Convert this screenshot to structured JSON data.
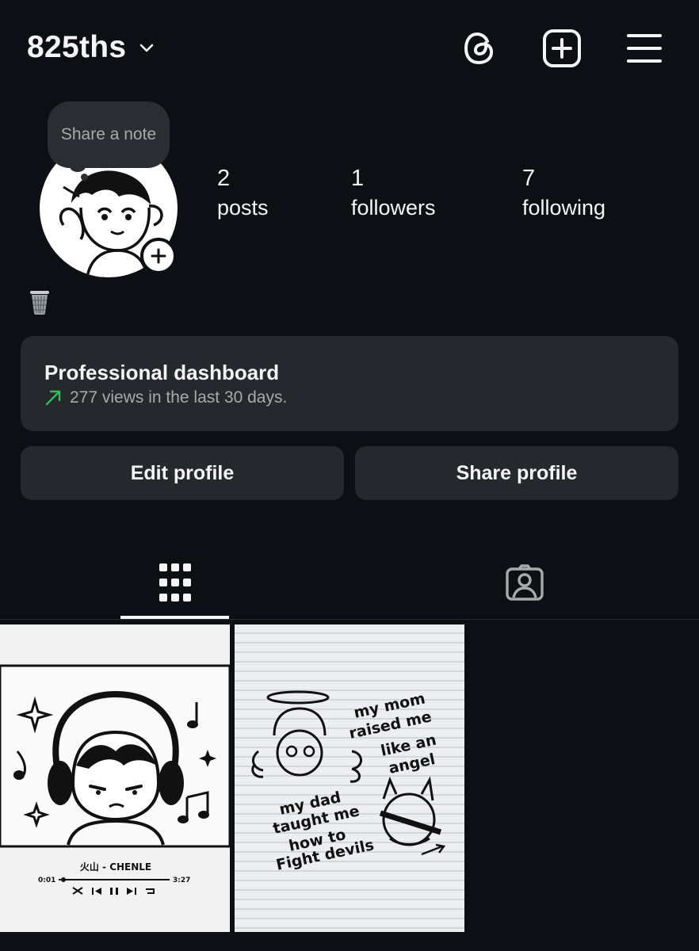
{
  "header": {
    "username": "825ths",
    "icons": [
      "chevron-down-icon",
      "threads-icon",
      "new-post-icon",
      "menu-icon"
    ]
  },
  "note": {
    "placeholder": "Share a note"
  },
  "stats": [
    {
      "value": "2",
      "label": "posts"
    },
    {
      "value": "1",
      "label": "followers"
    },
    {
      "value": "7",
      "label": "following"
    }
  ],
  "bio": {
    "emoji": "wastebasket"
  },
  "dashboard": {
    "title": "Professional dashboard",
    "subtitle": "277 views in the last 30 days.",
    "accent_color": "#2fbf55"
  },
  "buttons": {
    "edit_profile": "Edit profile",
    "share_profile": "Share profile"
  },
  "tabs": [
    {
      "name": "posts-grid",
      "icon": "grid-icon",
      "active": true
    },
    {
      "name": "tagged",
      "icon": "tagged-person-icon",
      "active": false
    }
  ],
  "posts": [
    {
      "type": "music-player-illustration",
      "song": "火山 - CHENLE",
      "time_elapsed": "0:01",
      "time_total": "3:27"
    },
    {
      "type": "lined-paper-doodle",
      "text_top": [
        "my mom",
        "raised me",
        "like an",
        "angel"
      ],
      "text_bottom": [
        "my dad",
        "taught me",
        "how to",
        "Fight devils"
      ]
    }
  ],
  "colors": {
    "background": "#0c1014",
    "surface": "#25292e",
    "text_primary": "#f5f5f5",
    "text_secondary": "#a8a9ad"
  }
}
